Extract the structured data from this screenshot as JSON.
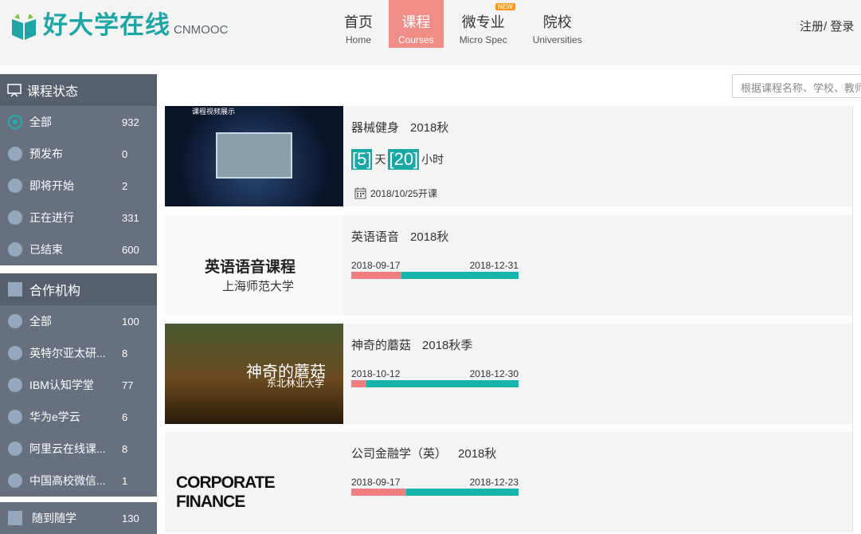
{
  "header": {
    "logo_text": "好大学在线",
    "logo_sub": "CNMOOC",
    "nav": [
      {
        "zh": "首页",
        "en": "Home"
      },
      {
        "zh": "课程",
        "en": "Courses",
        "active": true
      },
      {
        "zh": "微专业",
        "en": "Micro Spec",
        "badge": "NEW"
      },
      {
        "zh": "院校",
        "en": "Universities"
      }
    ],
    "auth": "注册/ 登录"
  },
  "search": {
    "placeholder": "根据课程名称、学校、教师"
  },
  "sidebar": {
    "status": {
      "title": "课程状态",
      "items": [
        {
          "label": "全部",
          "count": "932",
          "selected": true
        },
        {
          "label": "预发布",
          "count": "0"
        },
        {
          "label": "即将开始",
          "count": "2"
        },
        {
          "label": "正在进行",
          "count": "331"
        },
        {
          "label": "已结束",
          "count": "600"
        }
      ]
    },
    "org": {
      "title": "合作机构",
      "items": [
        {
          "label": "全部",
          "count": "100"
        },
        {
          "label": "英特尔亚太研...",
          "count": "8"
        },
        {
          "label": "IBM认知学堂",
          "count": "77"
        },
        {
          "label": "华为e学云",
          "count": "6"
        },
        {
          "label": "阿里云在线课...",
          "count": "8"
        },
        {
          "label": "中国高校微信...",
          "count": "1"
        }
      ]
    },
    "anytime": {
      "label": "随到随学",
      "count": "130"
    }
  },
  "courses": [
    {
      "title": "器械健身",
      "term": "2018秋",
      "thumb_text": "课程视频展示",
      "countdown": {
        "days": "[5]",
        "day_unit": "天",
        "hours": "[20]",
        "hour_unit": "小时"
      },
      "start": "2018/10/25开课"
    },
    {
      "title": "英语语音",
      "term": "2018秋",
      "thumb_text": "英语语音课程",
      "thumb_sub": "上海师范大学",
      "start_date": "2018-09-17",
      "end_date": "2018-12-31",
      "progress_pct": 30
    },
    {
      "title": "神奇的蘑菇",
      "term": "2018秋季",
      "thumb_text": "神奇的蘑菇",
      "thumb_sub": "东北林业大学",
      "start_date": "2018-10-12",
      "end_date": "2018-12-30",
      "progress_pct": 9
    },
    {
      "title": "公司金融学（英）",
      "term": "2018秋",
      "thumb_text": "CORPORATE FINANCE",
      "start_date": "2018-09-17",
      "end_date": "2018-12-23",
      "progress_pct": 33
    }
  ],
  "colors": {
    "accent": "#18b5ad",
    "active_nav": "#f08d86",
    "sidebar_head": "#56606c",
    "sidebar_item": "#66707e"
  }
}
